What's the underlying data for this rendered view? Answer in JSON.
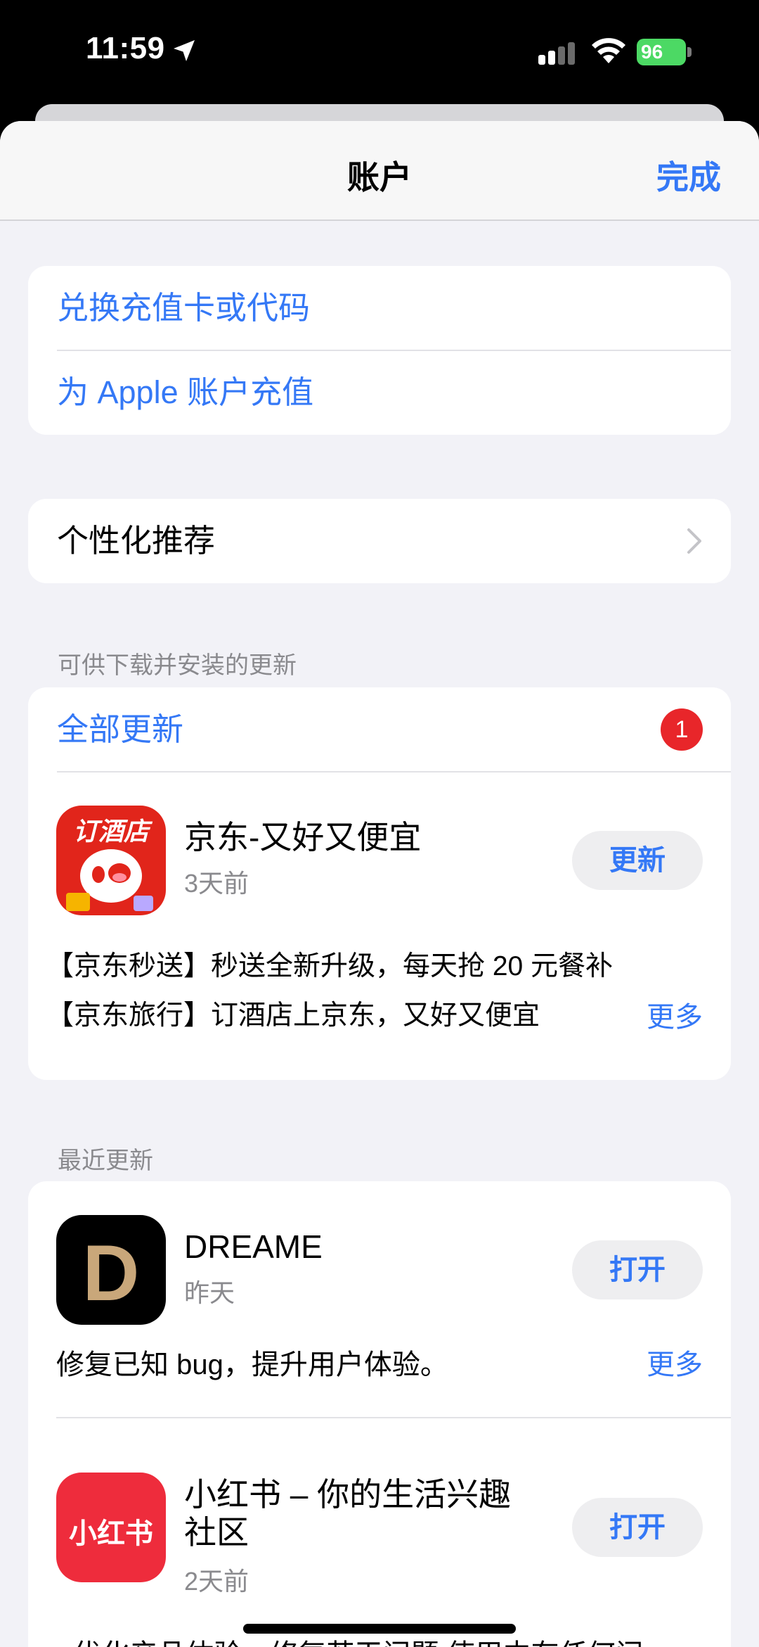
{
  "status_bar": {
    "time": "11:59",
    "battery": "96"
  },
  "nav": {
    "title": "账户",
    "done": "完成"
  },
  "account_links": {
    "redeem": "兑换充值卡或代码",
    "add_funds": "为 Apple 账户充值"
  },
  "personalized": {
    "label": "个性化推荐"
  },
  "updates_available": {
    "header": "可供下载并安装的更新",
    "update_all": "全部更新",
    "badge_count": "1",
    "app": {
      "icon_text": "订酒店",
      "name": "京东-又好又便宜",
      "date": "3天前",
      "button": "更新",
      "notes": [
        "【京东秒送】秒送全新升级，每天抢 20 元餐补",
        "【京东旅行】订酒店上京东，又好又便宜"
      ],
      "more": "更多"
    }
  },
  "recent_updates": {
    "header": "最近更新",
    "apps": [
      {
        "name": "DREAME",
        "date": "昨天",
        "button": "打开",
        "note": "修复已知 bug，提升用户体验。",
        "more": "更多",
        "icon_letter": "D"
      },
      {
        "name_line1": "小红书 – 你的生活兴趣",
        "name_line2": "社区",
        "date": "2天前",
        "button": "打开",
        "icon_text": "小红书",
        "note": "- 优化产品体验，修复若干问题,使用中有任何问"
      }
    ]
  },
  "colors": {
    "accent": "#3478f6",
    "badge": "#e8262a",
    "battery": "#4cd964"
  }
}
